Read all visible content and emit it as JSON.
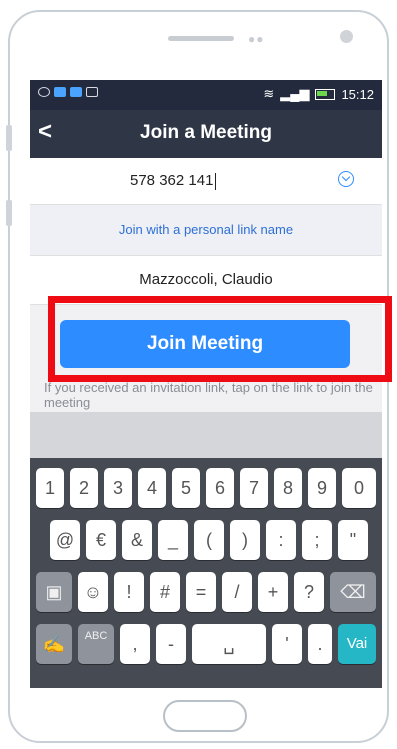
{
  "statusbar": {
    "time": "15:12"
  },
  "header": {
    "back_label": "<",
    "title": "Join a Meeting"
  },
  "meeting": {
    "id_value": "578 362 141"
  },
  "personal_link": {
    "label": "Join with a personal link name"
  },
  "user": {
    "name_value": "Mazzoccoli, Claudio"
  },
  "join_button": {
    "label": "Join Meeting"
  },
  "invite_hint": {
    "text": "If you received an invitation link, tap on the link to join the meeting"
  },
  "keyboard": {
    "row1": [
      "1",
      "2",
      "3",
      "4",
      "5",
      "6",
      "7",
      "8",
      "9",
      "0"
    ],
    "row2": [
      "@",
      "€",
      "&",
      "_",
      "(",
      ")",
      ":",
      ";",
      "\""
    ],
    "row3": [
      "!",
      "#",
      "=",
      "/",
      "+",
      "?"
    ],
    "row4": {
      "abc": "ABC",
      "comma": ",",
      "dash": "-",
      "apostrophe": "'",
      "period": ".",
      "go": "Vai"
    }
  },
  "colors": {
    "accent": "#2d8cff",
    "header": "#2f3747",
    "statusbar": "#232a3d",
    "highlight": "#ee0b14",
    "go_key": "#26b7c7"
  }
}
